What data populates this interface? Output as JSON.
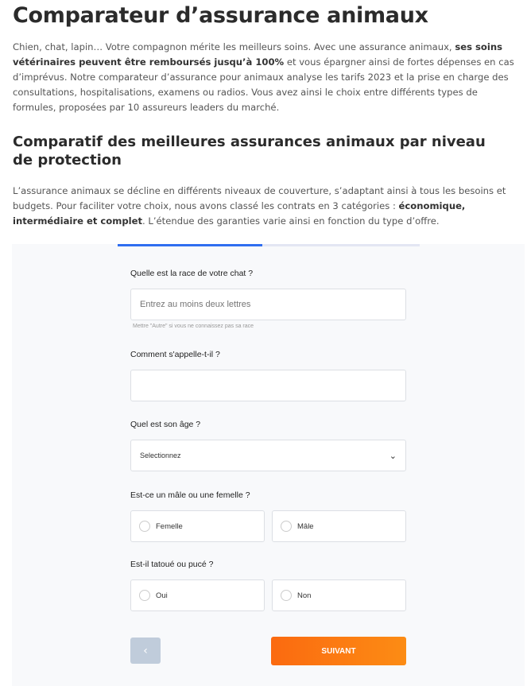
{
  "title": "Comparateur d’assurance animaux",
  "intro": {
    "part1": "Chien, chat, lapin… Votre compagnon mérite les meilleurs soins. Avec une assurance animaux, ",
    "bold": "ses soins vétérinaires peuvent être remboursés jusqu’à 100%",
    "part2": " et vous épargner ainsi de fortes dépenses en cas d’imprévus. Notre comparateur d’assurance pour animaux analyse les tarifs 2023 et la prise en charge des consultations, hospitalisations, examens ou radios. Vous avez ainsi le choix entre différents types de formules, proposées par 10 assureurs leaders du marché."
  },
  "subtitle": "Comparatif des meilleures assurances animaux par niveau de protection",
  "para2": {
    "part1": "L’assurance animaux se décline en différents niveaux de couverture, s’adaptant ainsi à tous les besoins et budgets. Pour faciliter votre choix, nous avons classé les contrats en 3 catégories : ",
    "bold": "économique, intermédiaire et complet",
    "part2": ". L’étendue des garanties varie ainsi en fonction du type d’offre."
  },
  "form": {
    "progress_percent": 48,
    "progress_color": "#2f6ef0",
    "race_label": "Quelle est la race de votre chat ?",
    "race_placeholder": "Entrez au moins deux lettres",
    "race_hint": "Mettre \"Autre\" si vous ne connaissez pas sa race",
    "name_label": "Comment s'appelle-t-il ?",
    "name_value": "",
    "age_label": "Quel est son âge ?",
    "age_selected": "Selectionnez",
    "sex_label": "Est-ce un mâle ou une femelle ?",
    "sex_options": [
      "Femelle",
      "Mâle"
    ],
    "chip_label": "Est-il tatoué ou pucé ?",
    "chip_options": [
      "Oui",
      "Non"
    ],
    "back_icon": "chevron-left-icon",
    "next_label": "SUIVANT"
  }
}
